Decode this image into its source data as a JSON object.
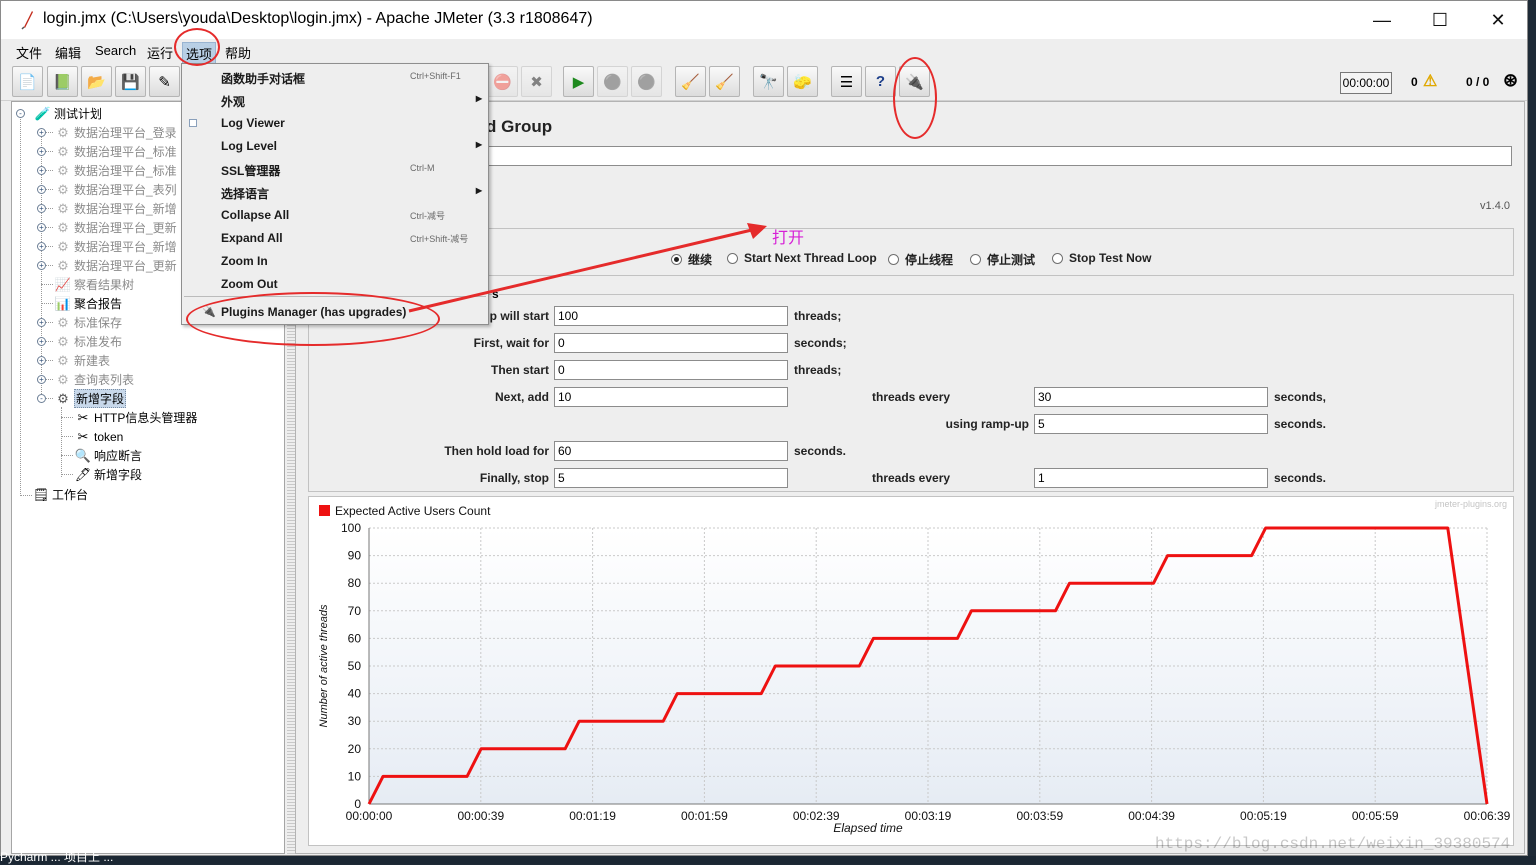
{
  "window": {
    "title": "login.jmx (C:\\Users\\youda\\Desktop\\login.jmx) - Apache JMeter (3.3 r1808647)",
    "minimize": "—",
    "maximize": "☐",
    "close": "✕"
  },
  "menubar": {
    "items": [
      "文件",
      "编辑",
      "Search",
      "运行",
      "选项",
      "帮助"
    ],
    "active": "选项"
  },
  "toolbar": {
    "timer": "00:00:00",
    "errors": "0",
    "threads": "0 / 0",
    "buttons": [
      "new-icon",
      "templates-icon",
      "open-icon",
      "save-icon",
      "save-as-icon",
      "cut-icon",
      "copy-icon",
      "paste-icon",
      "expand-icon",
      "collapse-icon",
      "toggle-icon",
      "start-icon",
      "start-no-pause-icon",
      "stop-icon",
      "shutdown-icon",
      "remote-start-icon",
      "remote-start-all-icon",
      "remote-stop-icon",
      "clear-icon",
      "clear-all-icon",
      "search-icon",
      "reset-search-icon",
      "function-helper-icon",
      "help-icon",
      "plugins-manager-icon"
    ]
  },
  "tree": {
    "root": "测试计划",
    "items": [
      {
        "label": "数据治理平台_登录",
        "gray": true
      },
      {
        "label": "数据治理平台_标准",
        "gray": true
      },
      {
        "label": "数据治理平台_标准",
        "gray": true
      },
      {
        "label": "数据治理平台_表列",
        "gray": true
      },
      {
        "label": "数据治理平台_新增",
        "gray": true
      },
      {
        "label": "数据治理平台_更新",
        "gray": true
      },
      {
        "label": "数据治理平台_新增",
        "gray": true
      },
      {
        "label": "数据治理平台_更新",
        "gray": true
      },
      {
        "label": "察看结果树",
        "gray": true
      },
      {
        "label": "聚合报告",
        "gray": false
      },
      {
        "label": "标准保存",
        "gray": true
      },
      {
        "label": "标准发布",
        "gray": true
      },
      {
        "label": "新建表",
        "gray": true
      },
      {
        "label": "查询表列表",
        "gray": true
      },
      {
        "label": "新增字段",
        "gray": false,
        "selected": true
      }
    ],
    "children": [
      "HTTP信息头管理器",
      "token",
      "响应断言",
      "新增字段"
    ],
    "workbench": "工作台"
  },
  "menu": {
    "items": [
      {
        "label": "函数助手对话框",
        "shortcut": "Ctrl+Shift-F1"
      },
      {
        "label": "外观",
        "submenu": true
      },
      {
        "label": "Log Viewer",
        "checkbox": true
      },
      {
        "label": "Log Level",
        "submenu": true
      },
      {
        "label": "SSL管理器",
        "shortcut": "Ctrl-M"
      },
      {
        "label": "选择语言",
        "submenu": true
      },
      {
        "label": "Collapse All",
        "shortcut": "Ctrl-减号"
      },
      {
        "label": "Expand All",
        "shortcut": "Ctrl+Shift-减号"
      },
      {
        "label": "Zoom In"
      },
      {
        "label": "Zoom Out"
      }
    ],
    "plugins": "Plugins Manager (has upgrades)"
  },
  "panel": {
    "heading": "d Group",
    "version": "v1.4.0",
    "actions": [
      "继续",
      "Start Next Thread Loop",
      "停止线程",
      "停止测试",
      "Stop Test Now"
    ],
    "selected_action": "继续",
    "params_legend": "s",
    "rows": [
      {
        "label": "p will start",
        "value": "100",
        "unit": "threads;"
      },
      {
        "label": "First, wait for",
        "value": "0",
        "unit": "seconds;"
      },
      {
        "label": "Then start",
        "value": "0",
        "unit": "threads;"
      },
      {
        "label": "Next, add",
        "value": "10",
        "unit": "threads every",
        "value2": "30",
        "unit2": "seconds,"
      },
      {
        "label": "using ramp-up",
        "value2": "5",
        "unit2": "seconds."
      },
      {
        "label": "Then hold load for",
        "value": "60",
        "unit": "seconds."
      },
      {
        "label": "Finally, stop",
        "value": "5",
        "unit": "threads every",
        "value2": "1",
        "unit2": "seconds."
      }
    ]
  },
  "annotation": {
    "open_text": "打开"
  },
  "chart_data": {
    "type": "line",
    "title": "",
    "legend": "Expected Active Users Count",
    "credit": "jmeter-plugins.org",
    "xlabel": "Elapsed time",
    "ylabel": "Number of active threads",
    "ylim": [
      0,
      100
    ],
    "yticks": [
      "0",
      "10",
      "20",
      "30",
      "40",
      "50",
      "60",
      "70",
      "80",
      "90",
      "100"
    ],
    "xticks": [
      "00:00:00",
      "00:00:39",
      "00:01:19",
      "00:01:59",
      "00:02:39",
      "00:03:19",
      "00:03:59",
      "00:04:39",
      "00:05:19",
      "00:05:59",
      "00:06:39"
    ],
    "xlim_seconds": [
      0,
      399
    ],
    "color": "#ee1111",
    "series": [
      {
        "name": "Expected Active Users Count",
        "x": [
          0,
          5,
          35,
          40,
          70,
          75,
          105,
          110,
          140,
          145,
          175,
          180,
          210,
          215,
          245,
          250,
          280,
          285,
          315,
          320,
          350,
          355,
          385,
          399
        ],
        "y": [
          0,
          10,
          10,
          20,
          20,
          30,
          30,
          40,
          40,
          50,
          50,
          60,
          60,
          70,
          70,
          80,
          80,
          90,
          90,
          100,
          100,
          100,
          100,
          0
        ]
      }
    ],
    "grid": true
  },
  "watermark": "https://blog.csdn.net/weixin_39380574",
  "taskbar_text": "Pycharm ...  项目上 ..."
}
